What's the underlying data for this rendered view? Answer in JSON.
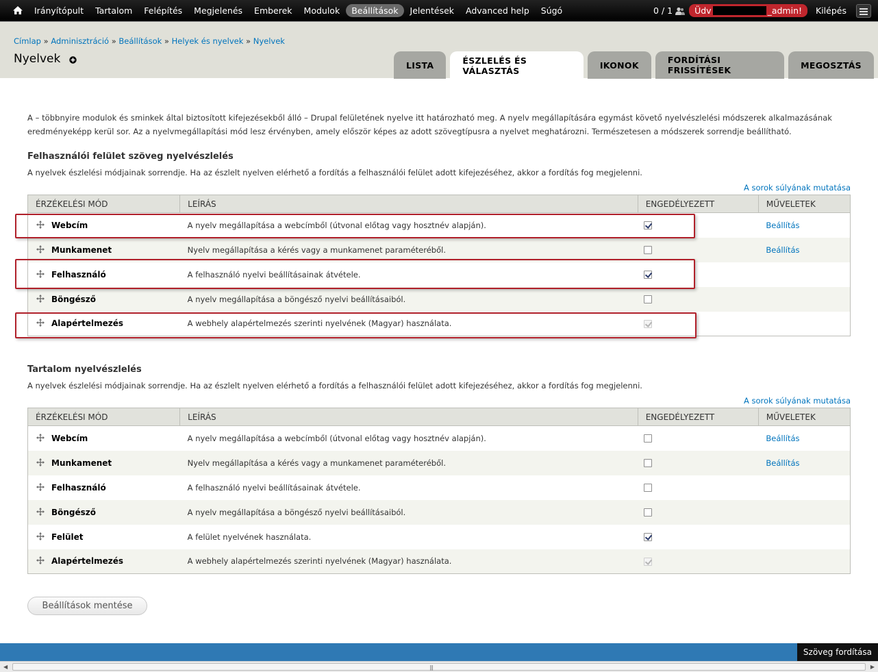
{
  "toolbar": {
    "menu": [
      "Irányítópult",
      "Tartalom",
      "Felépítés",
      "Megjelenés",
      "Emberek",
      "Modulok",
      "Beállítások",
      "Jelentések",
      "Advanced help",
      "Súgó"
    ],
    "active_item": "Beállítások",
    "counter": "0 / 1",
    "welcome_prefix": "Üdv",
    "welcome_suffix": "_admin!",
    "logout": "Kilépés"
  },
  "breadcrumb": [
    "Címlap",
    "Adminisztráció",
    "Beállítások",
    "Helyek és nyelvek",
    "Nyelvek"
  ],
  "page_title": "Nyelvek",
  "tabs": [
    "Lista",
    "Észlelés és választás",
    "Ikonok",
    "Fordítási frissítések",
    "Megosztás"
  ],
  "active_tab": "Észlelés és választás",
  "description": "A – többnyire modulok és sminkek által biztosított kifejezésekből álló – Drupal felületének nyelve itt határozható meg. A nyelv megállapítására egymást követő nyelvészlelési módszerek alkalmazásának eredményeképp kerül sor. Az a nyelvmegállapítási mód lesz érvényben, amely először képes az adott szövegtípusra a nyelvet meghatározni. Természetesen a módszerek sorrendje beállítható.",
  "columns": [
    "Érzékelési mód",
    "Leírás",
    "Engedélyezett",
    "Műveletek"
  ],
  "weights_link": "A sorok súlyának mutatása",
  "ui_section": {
    "title": "Felhasználói felület szöveg nyelvészlelés",
    "subtitle": "A nyelvek észlelési módjainak sorrendje. Ha az észlelt nyelven elérhető a fordítás a felhasználói felület adott kifejezéséhez, akkor a fordítás fog megjelenni.",
    "rows": [
      {
        "mode": "Webcím",
        "desc": "A nyelv megállapítása a webcímből (útvonal előtag vagy hosztnév alapján).",
        "enabled": true,
        "disabled": false,
        "op": "Beállítás"
      },
      {
        "mode": "Munkamenet",
        "desc": "Nyelv megállapítása a kérés vagy a munkamenet paraméteréből.",
        "enabled": false,
        "disabled": false,
        "op": "Beállítás"
      },
      {
        "mode": "Felhasználó",
        "desc": "A felhasználó nyelvi beállításainak átvétele.",
        "enabled": true,
        "disabled": false,
        "op": ""
      },
      {
        "mode": "Böngésző",
        "desc": "A nyelv megállapítása a böngésző nyelvi beállításaiból.",
        "enabled": false,
        "disabled": false,
        "op": ""
      },
      {
        "mode": "Alapértelmezés",
        "desc": "A webhely alapértelmezés szerinti nyelvének (Magyar) használata.",
        "enabled": true,
        "disabled": true,
        "op": ""
      }
    ]
  },
  "content_section": {
    "title": "Tartalom nyelvészlelés",
    "subtitle": "A nyelvek észlelési módjainak sorrendje. Ha az észlelt nyelven elérhető a fordítás a felhasználói felület adott kifejezéséhez, akkor a fordítás fog megjelenni.",
    "rows": [
      {
        "mode": "Webcím",
        "desc": "A nyelv megállapítása a webcímből (útvonal előtag vagy hosztnév alapján).",
        "enabled": false,
        "disabled": false,
        "op": "Beállítás"
      },
      {
        "mode": "Munkamenet",
        "desc": "Nyelv megállapítása a kérés vagy a munkamenet paraméteréből.",
        "enabled": false,
        "disabled": false,
        "op": "Beállítás"
      },
      {
        "mode": "Felhasználó",
        "desc": "A felhasználó nyelvi beállításainak átvétele.",
        "enabled": false,
        "disabled": false,
        "op": ""
      },
      {
        "mode": "Böngésző",
        "desc": "A nyelv megállapítása a böngésző nyelvi beállításaiból.",
        "enabled": false,
        "disabled": false,
        "op": ""
      },
      {
        "mode": "Felület",
        "desc": "A felület nyelvének használata.",
        "enabled": true,
        "disabled": false,
        "op": ""
      },
      {
        "mode": "Alapértelmezés",
        "desc": "A webhely alapértelmezés szerinti nyelvének (Magyar) használata.",
        "enabled": true,
        "disabled": true,
        "op": ""
      }
    ]
  },
  "save_button": "Beállítások mentése",
  "translate_button": "Szöveg fordítása",
  "colors": {
    "accent_link": "#0074bd",
    "welcome_badge": "#c0262d",
    "highlight_box": "#b0202a",
    "footer_bar": "#2f79b4"
  },
  "icons": [
    "home-icon",
    "users-icon",
    "plus-icon",
    "drag-handle-icon",
    "menu-toggle-icon"
  ]
}
